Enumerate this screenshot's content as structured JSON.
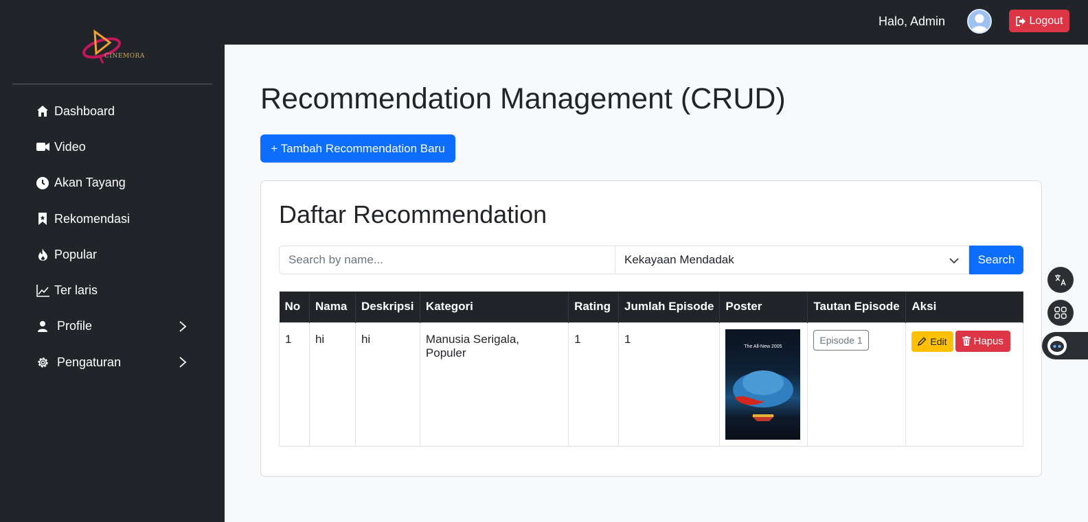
{
  "header": {
    "greeting": "Halo, Admin",
    "logout_label": "Logout"
  },
  "brand": {
    "logo_text": "CINEMORA"
  },
  "sidebar": {
    "items": [
      {
        "label": "Dashboard",
        "icon": "home-icon"
      },
      {
        "label": "Video",
        "icon": "video-camera-icon"
      },
      {
        "label": "Akan Tayang",
        "icon": "clock-icon"
      },
      {
        "label": "Rekomendasi",
        "icon": "bookmark-icon"
      },
      {
        "label": "Popular",
        "icon": "fire-icon"
      },
      {
        "label": "Ter laris",
        "icon": "line-chart-icon"
      },
      {
        "label": "Profile",
        "icon": "user-icon",
        "has_submenu": true
      },
      {
        "label": "Pengaturan",
        "icon": "gear-icon",
        "has_submenu": true
      }
    ]
  },
  "main": {
    "title": "Recommendation Management (CRUD)",
    "add_button": "+ Tambah Recommendation Baru",
    "card_title": "Daftar Recommendation",
    "search": {
      "placeholder": "Search by name...",
      "value": "",
      "category_selected": "Kekayaan Mendadak",
      "button": "Search"
    },
    "table": {
      "columns": [
        "No",
        "Nama",
        "Deskripsi",
        "Kategori",
        "Rating",
        "Jumlah Episode",
        "Poster",
        "Tautan Episode",
        "Aksi"
      ],
      "rows": [
        {
          "no": "1",
          "nama": "hi",
          "deskripsi": "hi",
          "kategori": "Manusia Serigala, Populer",
          "rating": "1",
          "jumlah_episode": "1",
          "poster_caption": "The All-New 2005",
          "episode_link": "Episode 1",
          "edit_label": "Edit",
          "delete_label": "Hapus"
        }
      ]
    }
  },
  "floating": {
    "icons": [
      "translate-icon",
      "apps-grid-icon",
      "assistant-bot-icon"
    ]
  },
  "colors": {
    "sidebar_bg": "#212529",
    "primary": "#0d6efd",
    "danger": "#dc3545",
    "warning": "#ffc107"
  }
}
